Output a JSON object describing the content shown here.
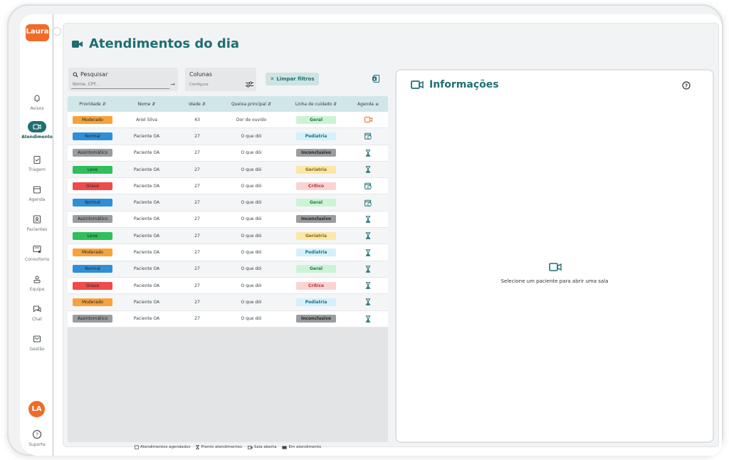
{
  "app": {
    "logo_text": "Laura"
  },
  "sidebar": {
    "items": [
      {
        "label": "Avisos",
        "icon": "bell-icon"
      },
      {
        "label": "Atendimento",
        "icon": "video-icon",
        "active": true
      },
      {
        "label": "Triagem",
        "icon": "clipboard-icon"
      },
      {
        "label": "Agenda",
        "icon": "calendar-icon"
      },
      {
        "label": "Pacientes",
        "icon": "patient-card-icon"
      },
      {
        "label": "Consultoria",
        "icon": "consult-icon"
      },
      {
        "label": "Equipe",
        "icon": "team-icon"
      },
      {
        "label": "Chat",
        "icon": "chat-icon"
      },
      {
        "label": "Gestão",
        "icon": "management-icon"
      }
    ],
    "avatar_initials": "LA",
    "support_label": "Suporte"
  },
  "page": {
    "title": "Atendimentos do dia"
  },
  "filters": {
    "search_label": "Pesquisar",
    "search_placeholder": "Nome, CPF...",
    "columns_label": "Colunas",
    "columns_sub": "Configure",
    "clear_label": "Limpar filtros"
  },
  "table": {
    "headers": [
      "Prioridade",
      "Nome",
      "Idade",
      "Queixa principal",
      "Linha de cuidado",
      "Agenda"
    ],
    "rows": [
      {
        "priority": "Moderado",
        "name": "Ariel Silva",
        "age": "43",
        "complaint": "Dor de ouvido",
        "line": "Geral",
        "agenda": "video-open"
      },
      {
        "priority": "Normal",
        "name": "Paciente OA",
        "age": "27",
        "complaint": "O que dói",
        "line": "Pediatria",
        "agenda": "scheduled"
      },
      {
        "priority": "Assintomático",
        "name": "Paciente OA",
        "age": "27",
        "complaint": "O que dói",
        "line": "Inconclusivo",
        "agenda": "hourglass"
      },
      {
        "priority": "Leve",
        "name": "Paciente OA",
        "age": "27",
        "complaint": "O que dói",
        "line": "Geriatria",
        "agenda": "hourglass"
      },
      {
        "priority": "Grave",
        "name": "Paciente OA",
        "age": "27",
        "complaint": "O que dói",
        "line": "Crítico",
        "agenda": "scheduled"
      },
      {
        "priority": "Normal",
        "name": "Paciente OA",
        "age": "27",
        "complaint": "O que dói",
        "line": "Geral",
        "agenda": "scheduled"
      },
      {
        "priority": "Assintomático",
        "name": "Paciente OA",
        "age": "27",
        "complaint": "O que dói",
        "line": "Inconclusivo",
        "agenda": "hourglass"
      },
      {
        "priority": "Leve",
        "name": "Paciente OA",
        "age": "27",
        "complaint": "O que dói",
        "line": "Geriatria",
        "agenda": "hourglass"
      },
      {
        "priority": "Moderado",
        "name": "Paciente OA",
        "age": "27",
        "complaint": "O que dói",
        "line": "Pediatria",
        "agenda": "hourglass"
      },
      {
        "priority": "Normal",
        "name": "Paciente OA",
        "age": "27",
        "complaint": "O que dói",
        "line": "Geral",
        "agenda": "hourglass"
      },
      {
        "priority": "Grave",
        "name": "Paciente OA",
        "age": "27",
        "complaint": "O que dói",
        "line": "Crítico",
        "agenda": "hourglass"
      },
      {
        "priority": "Moderado",
        "name": "Paciente OA",
        "age": "27",
        "complaint": "O que dói",
        "line": "Pediatria",
        "agenda": "hourglass"
      },
      {
        "priority": "Assintomático",
        "name": "Paciente OA",
        "age": "27",
        "complaint": "O que dói",
        "line": "Inconclusivo",
        "agenda": "hourglass"
      }
    ]
  },
  "priority_colors": {
    "Moderado": "#f7a33b",
    "Normal": "#2f8fd6",
    "Assintomático": "#9a9c9e",
    "Leve": "#2fbf5b",
    "Grave": "#ef4b4b"
  },
  "line_colors": {
    "Geral": {
      "bg": "#cdf3d6",
      "fg": "#1f7a3c"
    },
    "Pediatria": {
      "bg": "#d4f1fb",
      "fg": "#1f6f8a"
    },
    "Inconclusivo": {
      "bg": "#9a9c9e",
      "fg": "#1f2426"
    },
    "Geriatria": {
      "bg": "#fbe7a8",
      "fg": "#8a6a10"
    },
    "Crítico": {
      "bg": "#fbd3d3",
      "fg": "#b03030"
    }
  },
  "legend": {
    "scheduled": "Atendimentos agendados",
    "ready": "Pronto atendimentos",
    "room_open": "Sala aberta",
    "in_service": "Em atendimento"
  },
  "info": {
    "title": "Informações",
    "empty_message": "Selecione um paciente para abrir uma sala"
  },
  "colors": {
    "accent": "#1f6f72",
    "brand": "#f06a2a"
  }
}
